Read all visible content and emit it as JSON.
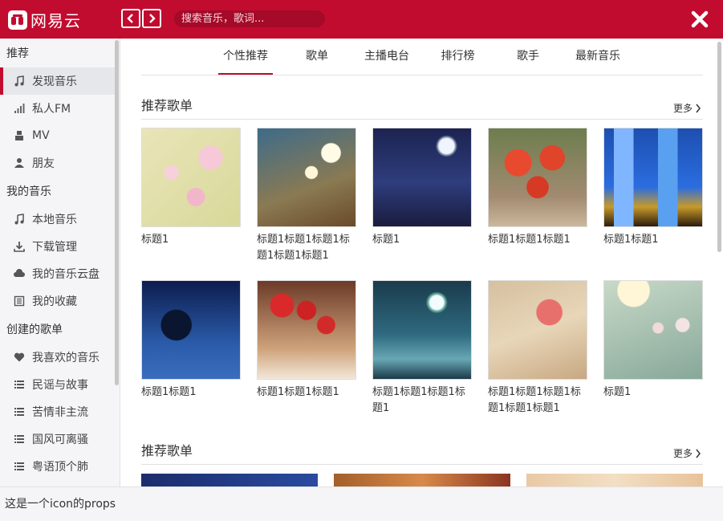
{
  "app": {
    "title": "网易云",
    "brand_color": "#c20c2f"
  },
  "search": {
    "placeholder": "搜索音乐，歌词..."
  },
  "sidebar": {
    "section1": "推荐",
    "section2": "我的音乐",
    "section3": "创建的歌单",
    "items1": [
      {
        "label": "发现音乐",
        "icon": "music-note-icon",
        "active": true
      },
      {
        "label": "私人FM",
        "icon": "signal-bars-icon"
      },
      {
        "label": "MV",
        "icon": "video-icon"
      },
      {
        "label": "朋友",
        "icon": "user-icon"
      }
    ],
    "items2": [
      {
        "label": "本地音乐",
        "icon": "music-note-icon"
      },
      {
        "label": "下载管理",
        "icon": "download-icon"
      },
      {
        "label": "我的音乐云盘",
        "icon": "cloud-icon"
      },
      {
        "label": "我的收藏",
        "icon": "bookmark-list-icon"
      }
    ],
    "items3": [
      {
        "label": "我喜欢的音乐",
        "icon": "heart-icon"
      },
      {
        "label": "民谣与故事",
        "icon": "list-icon"
      },
      {
        "label": "苦情非主流",
        "icon": "list-icon"
      },
      {
        "label": "国风可离骚",
        "icon": "list-icon"
      },
      {
        "label": "粤语顶个肺",
        "icon": "list-icon"
      }
    ]
  },
  "tabs": [
    "个性推荐",
    "歌单",
    "主播电台",
    "排行榜",
    "歌手",
    "最新音乐"
  ],
  "section_a": {
    "title": "推荐歌单",
    "more": "更多"
  },
  "section_b": {
    "title": "推荐歌单",
    "more": "更多"
  },
  "playlists": [
    {
      "title": "标题1"
    },
    {
      "title": "标题1标题1标题1标题1标题1标题1"
    },
    {
      "title": "标题1"
    },
    {
      "title": "标题1标题1标题1"
    },
    {
      "title": "标题1标题1"
    },
    {
      "title": "标题1标题1"
    },
    {
      "title": "标题1标题1标题1"
    },
    {
      "title": "标题1标题1标题1标题1"
    },
    {
      "title": "标题1标题1标题1标题1标题1标题1"
    },
    {
      "title": "标题1"
    }
  ],
  "footer": {
    "text": "这是一个icon的props"
  }
}
